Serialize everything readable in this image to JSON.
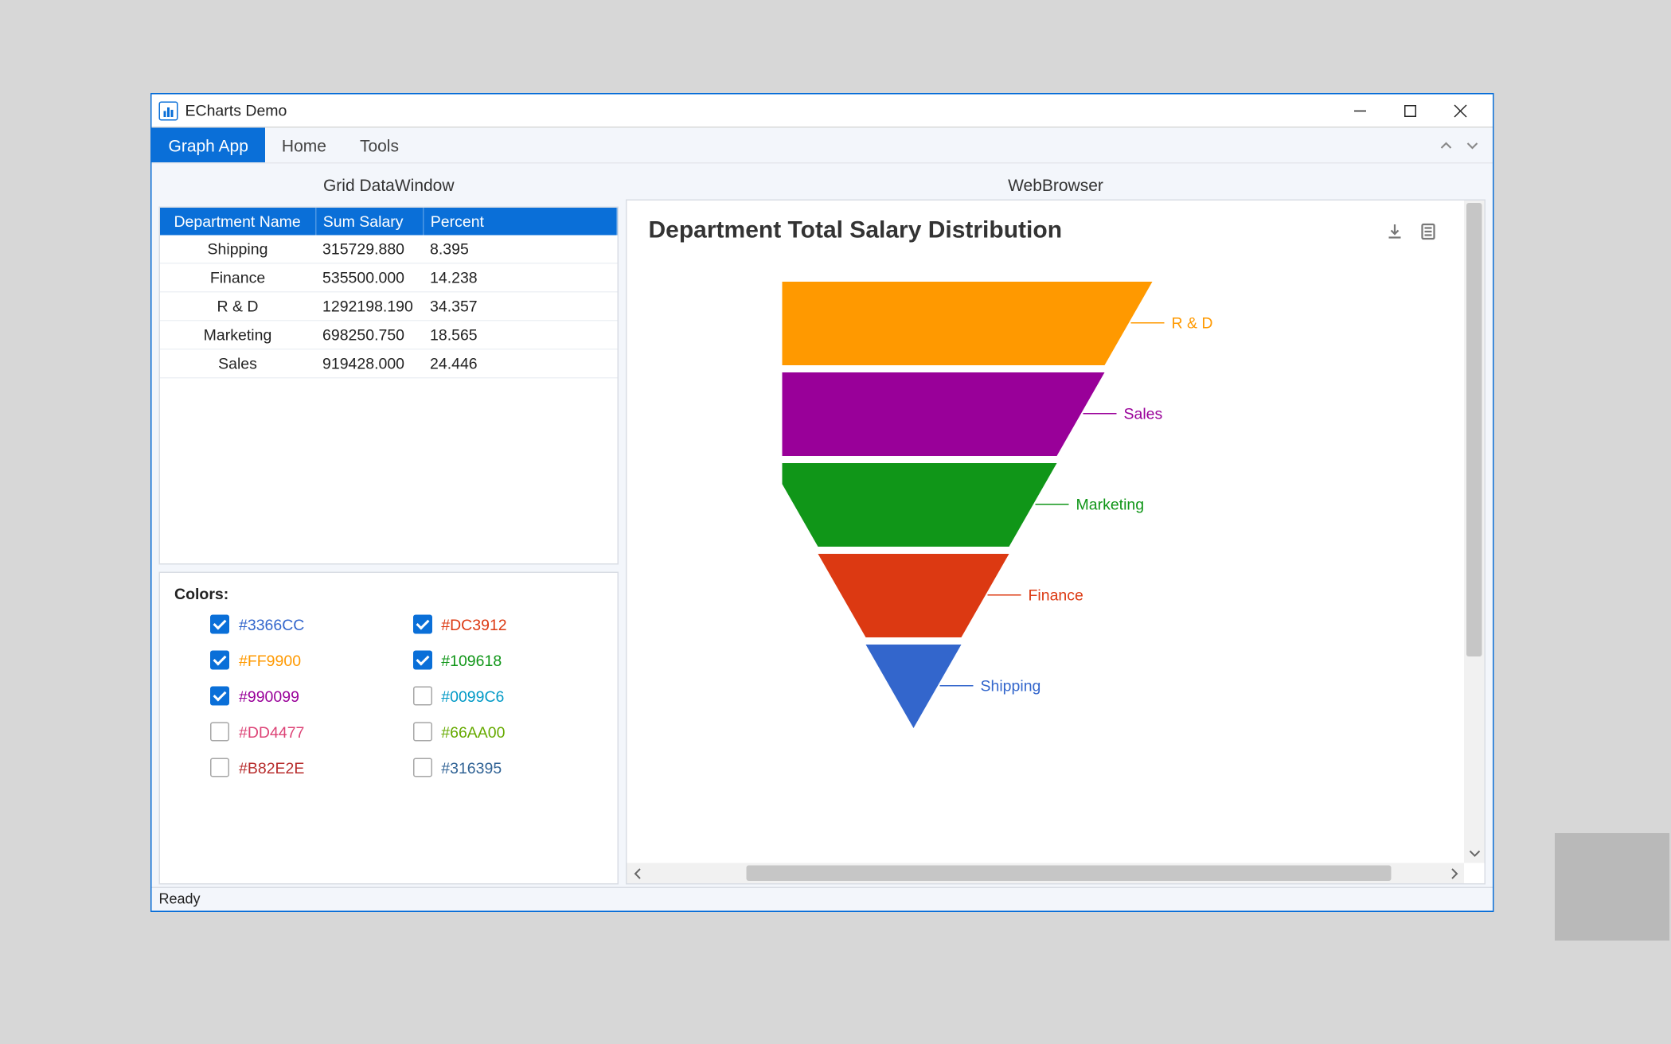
{
  "window": {
    "title": "ECharts Demo",
    "tabs": {
      "graph_app": "Graph App",
      "home": "Home",
      "tools": "Tools"
    },
    "status": "Ready"
  },
  "left": {
    "grid_title": "Grid DataWindow",
    "columns": {
      "dept": "Department Name",
      "sum": "Sum Salary",
      "pct": "Percent"
    },
    "rows": [
      {
        "dept": "Shipping",
        "sum": "315729.880",
        "pct": "8.395"
      },
      {
        "dept": "Finance",
        "sum": "535500.000",
        "pct": "14.238"
      },
      {
        "dept": "R & D",
        "sum": "1292198.190",
        "pct": "34.357"
      },
      {
        "dept": "Marketing",
        "sum": "698250.750",
        "pct": "18.565"
      },
      {
        "dept": "Sales",
        "sum": "919428.000",
        "pct": "24.446"
      }
    ],
    "colors_label": "Colors:",
    "colors": [
      {
        "hex": "#3366CC",
        "checked": true
      },
      {
        "hex": "#DC3912",
        "checked": true
      },
      {
        "hex": "#FF9900",
        "checked": true
      },
      {
        "hex": "#109618",
        "checked": true
      },
      {
        "hex": "#990099",
        "checked": true
      },
      {
        "hex": "#0099C6",
        "checked": false
      },
      {
        "hex": "#DD4477",
        "checked": false
      },
      {
        "hex": "#66AA00",
        "checked": false
      },
      {
        "hex": "#B82E2E",
        "checked": false
      },
      {
        "hex": "#316395",
        "checked": false
      }
    ]
  },
  "right": {
    "panel_title": "WebBrowser",
    "chart_title": "Department Total Salary Distribution",
    "segments": [
      {
        "name": "R & D",
        "color": "#FF9900"
      },
      {
        "name": "Sales",
        "color": "#990099"
      },
      {
        "name": "Marketing",
        "color": "#109618"
      },
      {
        "name": "Finance",
        "color": "#DC3912"
      },
      {
        "name": "Shipping",
        "color": "#3366CC"
      }
    ]
  },
  "chart_data": {
    "type": "funnel",
    "title": "Department Total Salary Distribution",
    "series": [
      {
        "name": "R & D",
        "value": 1292198.19,
        "percent": 34.357,
        "color": "#FF9900"
      },
      {
        "name": "Sales",
        "value": 919428.0,
        "percent": 24.446,
        "color": "#990099"
      },
      {
        "name": "Marketing",
        "value": 698250.75,
        "percent": 18.565,
        "color": "#109618"
      },
      {
        "name": "Finance",
        "value": 535500.0,
        "percent": 14.238,
        "color": "#DC3912"
      },
      {
        "name": "Shipping",
        "value": 315729.88,
        "percent": 8.395,
        "color": "#3366CC"
      }
    ]
  }
}
